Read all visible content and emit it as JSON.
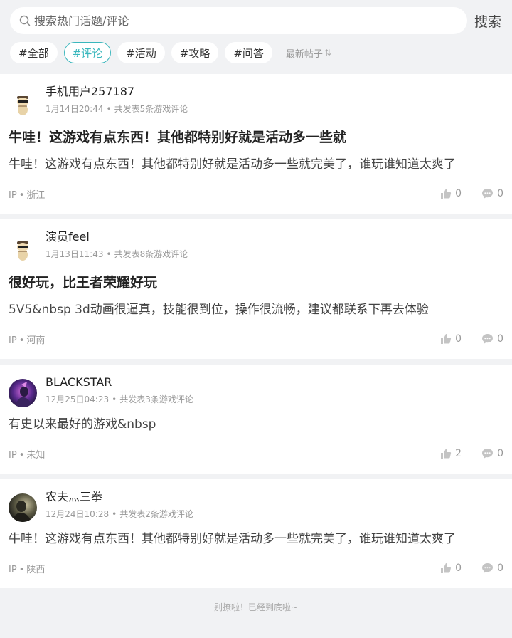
{
  "search": {
    "placeholder": "搜索热门话题/评论",
    "button_label": "搜索"
  },
  "tags": [
    {
      "label": "#全部",
      "active": false
    },
    {
      "label": "#评论",
      "active": true
    },
    {
      "label": "#活动",
      "active": false
    },
    {
      "label": "#攻略",
      "active": false
    },
    {
      "label": "#问答",
      "active": false
    }
  ],
  "sort": {
    "label": "最新帖子",
    "icon": "sort-arrows-icon"
  },
  "posts": [
    {
      "user": "手机用户257187",
      "date": "1月14日20:44",
      "count_text": "共发表5条游戏评论",
      "title": "牛哇！这游戏有点东西！其他都特别好就是活动多一些就",
      "body": "牛哇！这游戏有点东西！其他都特别好就是活动多一些就完美了，谁玩谁知道太爽了",
      "ip_label": "IP",
      "region": "浙江",
      "likes": "0",
      "comments": "0",
      "avatar_icon": "cartoon-avatar-icon"
    },
    {
      "user": "演员feel",
      "date": "1月13日11:43",
      "count_text": "共发表8条游戏评论",
      "title": "很好玩，比王者荣耀好玩",
      "body": "5V5&nbsp 3d动画很逼真，技能很到位，操作很流畅，建议都联系下再去体验",
      "ip_label": "IP",
      "region": "河南",
      "likes": "0",
      "comments": "0",
      "avatar_icon": "cartoon-avatar-icon"
    },
    {
      "user": "BLACKSTAR",
      "date": "12月25日04:23",
      "count_text": "共发表3条游戏评论",
      "title": "",
      "body": "有史以来最好的游戏&nbsp",
      "ip_label": "IP",
      "region": "未知",
      "likes": "2",
      "comments": "0",
      "avatar_icon": "purple-character-avatar-icon"
    },
    {
      "user": "农夫灬三拳",
      "date": "12月24日10:28",
      "count_text": "共发表2条游戏评论",
      "title": "",
      "body": "牛哇！这游戏有点东西！其他都特别好就是活动多一些就完美了，谁玩谁知道太爽了",
      "ip_label": "IP",
      "region": "陕西",
      "likes": "0",
      "comments": "0",
      "avatar_icon": "dark-portrait-avatar-icon"
    }
  ],
  "footer": {
    "end_text": "别撩啦！已经到底啦~"
  },
  "colors": {
    "accent": "#3ab7bd",
    "background": "#f1f2f4"
  }
}
